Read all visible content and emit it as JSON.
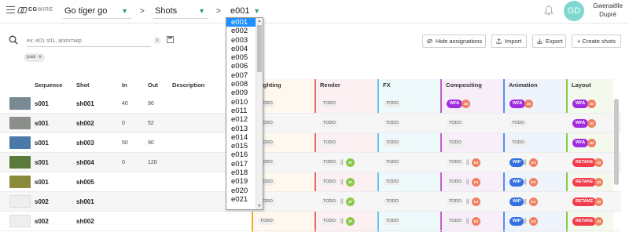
{
  "topbar": {
    "logo_text": "CG",
    "logo_text_light": "WIRE",
    "production": "Go tiger go",
    "section": "Shots",
    "episode": "e001",
    "separator": ">",
    "user_initials": "GD",
    "user_first": "Gwenaëlle",
    "user_last": "Dupré"
  },
  "toolbar": {
    "search_placeholder": "ex: e01 s01, anim=wip",
    "clear_label": "x",
    "filter_chip": "paul",
    "chip_close": "⊗",
    "hide_assignations": "Hide assignations",
    "import": "Import",
    "export": "Export",
    "create_shots": "+ Create shots"
  },
  "table": {
    "headers": {
      "sequence": "Sequence",
      "shot": "Shot",
      "in": "In",
      "out": "Out",
      "description": "Description"
    },
    "task_headers": [
      "Lighting",
      "Render",
      "FX",
      "Compositing",
      "Animation",
      "Layout"
    ],
    "task_colors": [
      "#f5a623",
      "#e8626e",
      "#5bc8e8",
      "#c05fc8",
      "#5a8ee8",
      "#8cc84b"
    ],
    "rows": [
      {
        "sequence": "s001",
        "shot": "sh001",
        "in": "40",
        "out": "90",
        "thumb": "#7a8a95",
        "lighting": "TODO",
        "render": "TODO",
        "fx": "TODO",
        "comp": "WFA",
        "comp_user": "JD",
        "anim": "WFA",
        "anim_user": "JD",
        "layout": "WFA",
        "layout_user": "JD"
      },
      {
        "sequence": "s001",
        "shot": "sh002",
        "in": "0",
        "out": "52",
        "thumb": "#8a8f8a",
        "lighting": "TODO",
        "render": "TODO",
        "fx": "TODO",
        "comp": "TODO",
        "anim": "TODO",
        "layout": "WFA",
        "layout_user": "JD"
      },
      {
        "sequence": "s001",
        "shot": "sh003",
        "in": "50",
        "out": "90",
        "thumb": "#4a7aa8",
        "lighting": "TODO",
        "render": "TODO",
        "fx": "TODO",
        "comp": "TODO",
        "anim": "TODO",
        "layout": "WFA",
        "layout_user": "JD"
      },
      {
        "sequence": "s001",
        "shot": "sh004",
        "in": "0",
        "out": "120",
        "thumb": "#5a7a3a",
        "lighting": "TODO",
        "render": "TODO",
        "render_user": "JF",
        "fx": "TODO",
        "comp": "TODO",
        "comp_user": "RJ",
        "anim": "WIP",
        "anim_user": "DV",
        "layout": "RETAKE",
        "layout_user": "JD"
      },
      {
        "sequence": "s001",
        "shot": "sh005",
        "in": "",
        "out": "",
        "thumb": "#8a8a3a",
        "lighting": "TODO",
        "render": "TODO",
        "render_user": "JF",
        "fx": "TODO",
        "comp": "TODO",
        "comp_user": "RJ",
        "anim": "WIP",
        "anim_user": "DV",
        "layout": "RETAKE",
        "layout_user": "JD"
      },
      {
        "sequence": "s002",
        "shot": "sh001",
        "in": "",
        "out": "",
        "thumb": "#eeeeee",
        "lighting": "TODO",
        "render": "TODO",
        "render_user": "JF",
        "fx": "TODO",
        "comp": "TODO",
        "comp_user": "RJ",
        "anim": "WIP",
        "anim_user": "DV",
        "layout": "RETAKE",
        "layout_user": "JD"
      },
      {
        "sequence": "s002",
        "shot": "sh002",
        "in": "",
        "out": "",
        "thumb": "#eeeeee",
        "lighting": "TODO",
        "render": "TODO",
        "render_user": "JF",
        "fx": "TODO",
        "comp": "TODO",
        "comp_user": "RJ",
        "anim": "WIP",
        "anim_user": "DV",
        "layout": "RETAKE",
        "layout_user": "JD"
      }
    ]
  },
  "dropdown": {
    "options": [
      "e001",
      "e002",
      "e003",
      "e004",
      "e005",
      "e006",
      "e007",
      "e008",
      "e009",
      "e010",
      "e011",
      "e012",
      "e013",
      "e014",
      "e015",
      "e016",
      "e017",
      "e018",
      "e019",
      "e020",
      "e021"
    ],
    "selected": "e001"
  }
}
